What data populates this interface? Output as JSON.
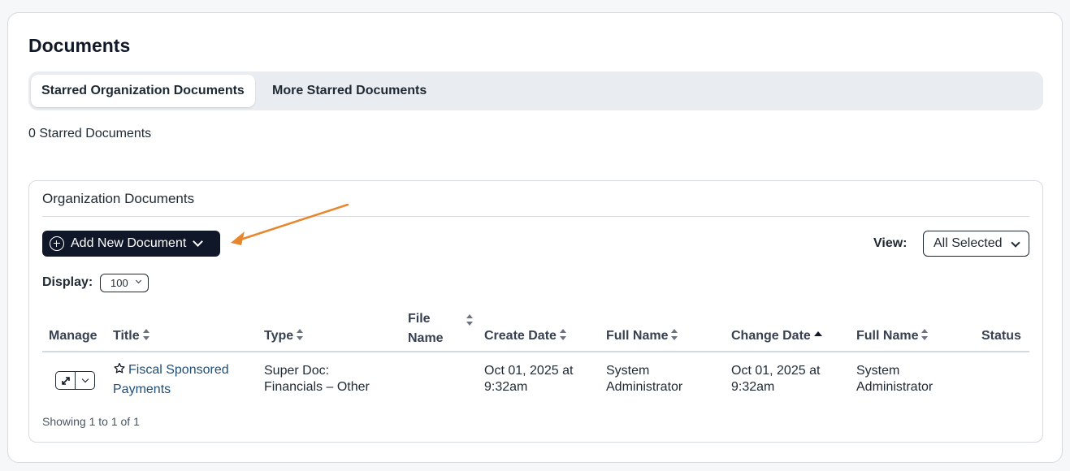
{
  "page": {
    "title": "Documents"
  },
  "tabs": [
    {
      "label": "Starred Organization Documents",
      "active": true
    },
    {
      "label": "More Starred Documents",
      "active": false
    }
  ],
  "starred_count_text": "0 Starred Documents",
  "org_panel": {
    "title": "Organization Documents",
    "add_button_label": "Add New Document",
    "add_button_icon": "plus-circle-icon",
    "view_label": "View:",
    "view_value": "All Selected",
    "display_label": "Display:",
    "display_value": "100",
    "columns": [
      "Manage",
      "Title",
      "Type",
      "File Name",
      "Create Date",
      "Full Name",
      "Change Date",
      "Full Name",
      "Status"
    ],
    "rows": [
      {
        "title_line1": "Fiscal Sponsored",
        "title_line2": "Payments",
        "type_line1": "Super Doc:",
        "type_line2": "Financials – Other",
        "file_name": "",
        "create_date_line1": "Oct 01, 2025 at",
        "create_date_line2": "9:32am",
        "created_by_line1": "System",
        "created_by_line2": "Administrator",
        "change_date_line1": "Oct 01, 2025 at",
        "change_date_line2": "9:32am",
        "changed_by_line1": "System",
        "changed_by_line2": "Administrator",
        "status": ""
      }
    ],
    "showing_text": "Showing 1 to 1 of 1"
  },
  "colors": {
    "primary_button": "#0f1729",
    "link": "#1f4e79",
    "annotation_arrow": "#e8862e"
  }
}
